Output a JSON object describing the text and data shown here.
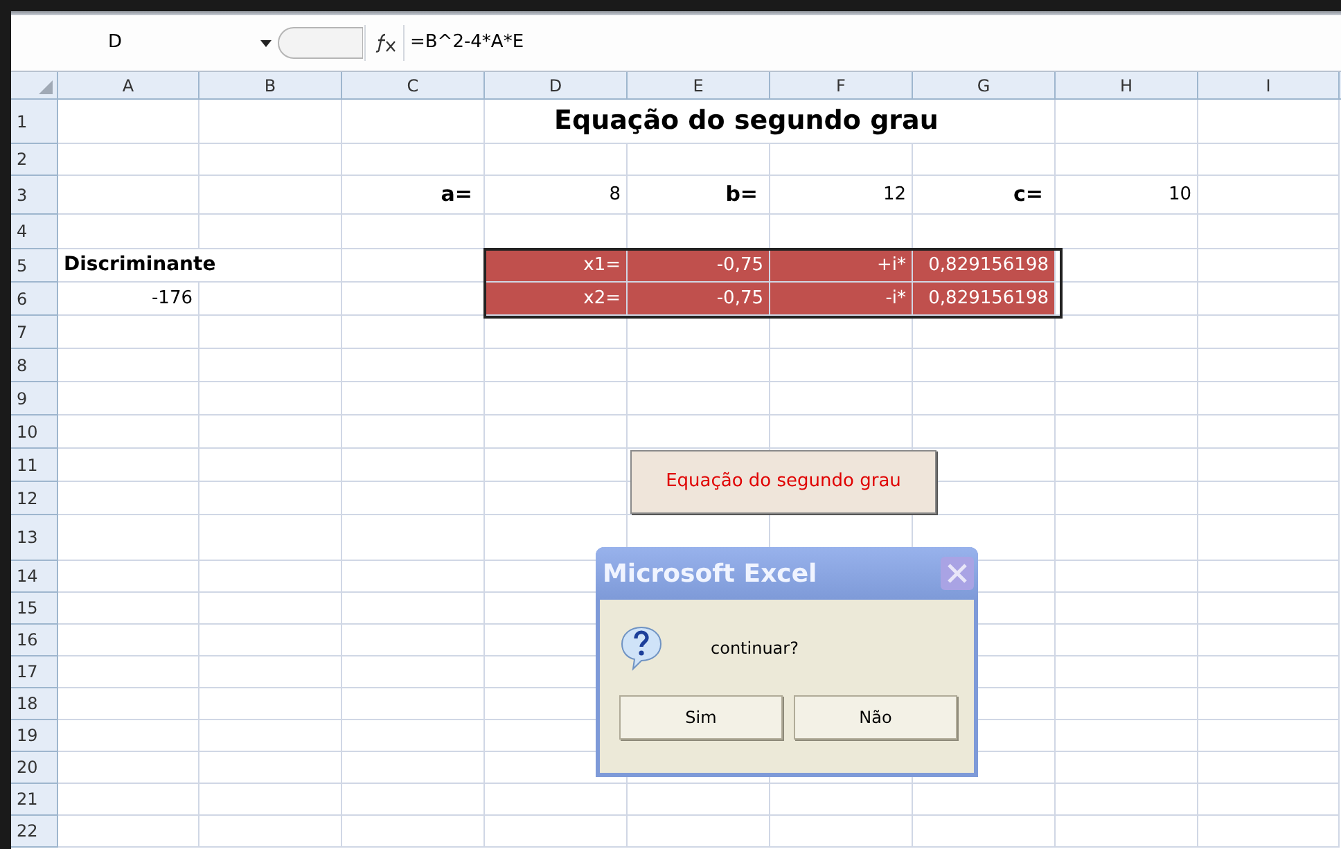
{
  "name_box": "D",
  "formula": "=B^2-4*A*E",
  "columns": [
    "A",
    "B",
    "C",
    "D",
    "E",
    "F",
    "G",
    "H",
    "I"
  ],
  "rows": [
    {
      "number": "1",
      "cells": {
        "D": {
          "kind": "title",
          "text": "Equação do segundo grau"
        }
      }
    },
    {
      "number": "2",
      "cells": {}
    },
    {
      "number": "3",
      "cells": {
        "C": {
          "kind": "label",
          "text": "a="
        },
        "D": {
          "kind": "value",
          "text": "8"
        },
        "E": {
          "kind": "label",
          "text": "b="
        },
        "F": {
          "kind": "value",
          "text": "12"
        },
        "G": {
          "kind": "label",
          "text": "c="
        },
        "H": {
          "kind": "value",
          "text": "10"
        }
      }
    },
    {
      "number": "4",
      "cells": {}
    },
    {
      "number": "5",
      "cells": {
        "A": {
          "kind": "heading",
          "text": "Discriminante"
        },
        "D": {
          "kind": "result",
          "text": "x1="
        },
        "E": {
          "kind": "result",
          "text": "-0,75"
        },
        "F": {
          "kind": "result",
          "text": "+i*"
        },
        "G": {
          "kind": "result",
          "text": "0,829156198"
        }
      }
    },
    {
      "number": "6",
      "cells": {
        "A": {
          "kind": "value",
          "text": "-176"
        },
        "D": {
          "kind": "result",
          "text": "x2="
        },
        "E": {
          "kind": "result",
          "text": "-0,75"
        },
        "F": {
          "kind": "result",
          "text": "-i*"
        },
        "G": {
          "kind": "result",
          "text": "0,829156198"
        }
      }
    },
    {
      "number": "7",
      "cells": {}
    },
    {
      "number": "8",
      "cells": {}
    },
    {
      "number": "9",
      "cells": {}
    },
    {
      "number": "10",
      "cells": {}
    },
    {
      "number": "11",
      "cells": {}
    },
    {
      "number": "12",
      "cells": {}
    },
    {
      "number": "13",
      "cells": {}
    },
    {
      "number": "14",
      "cells": {}
    },
    {
      "number": "15",
      "cells": {}
    },
    {
      "number": "16",
      "cells": {}
    },
    {
      "number": "17",
      "cells": {}
    },
    {
      "number": "18",
      "cells": {}
    },
    {
      "number": "19",
      "cells": {}
    },
    {
      "number": "20",
      "cells": {}
    },
    {
      "number": "21",
      "cells": {}
    },
    {
      "number": "22",
      "cells": {}
    }
  ],
  "form_button": {
    "label": "Equação do segundo grau"
  },
  "dialog": {
    "title": "Microsoft Excel",
    "message": "continuar?",
    "buttons": [
      "Sim",
      "Não"
    ]
  }
}
